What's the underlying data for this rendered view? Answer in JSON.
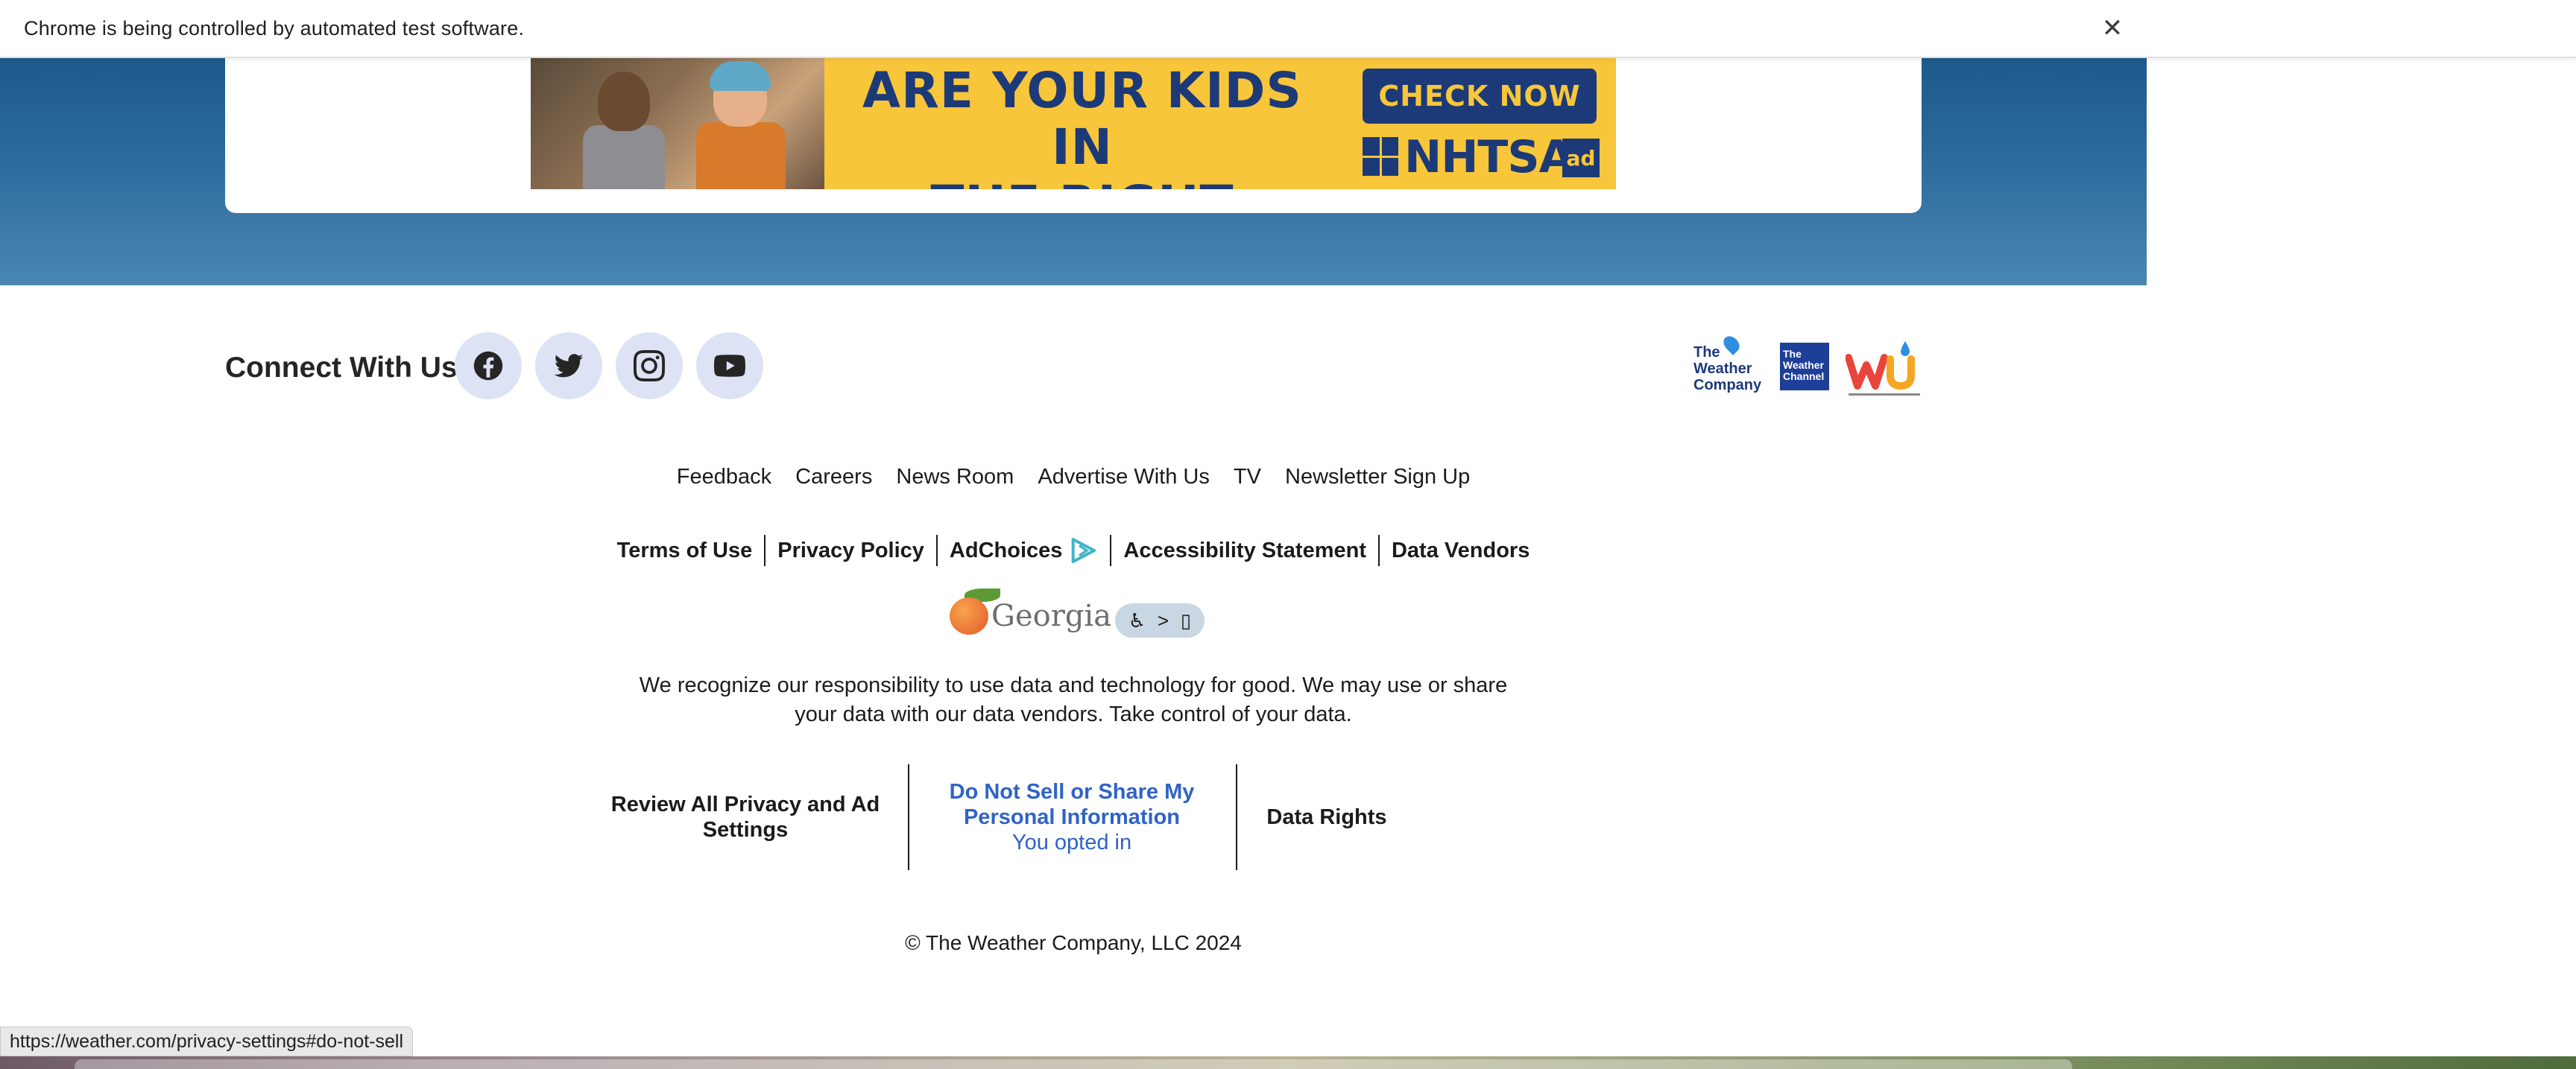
{
  "browser": {
    "infobar_text": "Chrome is being controlled by automated test software.",
    "close_glyph": "✕",
    "status_url": "https://weather.com/privacy-settings#do-not-sell"
  },
  "ad": {
    "headline_line1": "ARE YOUR KIDS IN",
    "headline_line2": "THE RIGHT SEAT?",
    "cta": "CHECK NOW",
    "sponsor": "NHTSA",
    "council": "ad",
    "colors": {
      "background": "#f8c63a",
      "text": "#1d3a78"
    }
  },
  "connect": {
    "title": "Connect With Us",
    "social_icons": [
      "facebook-icon",
      "twitter-icon",
      "instagram-icon",
      "youtube-icon"
    ]
  },
  "brands": {
    "weather_company": "The Weather Company",
    "weather_channel": "The Weather Channel",
    "wunderground": "Weather Underground"
  },
  "nav_links": [
    "Feedback",
    "Careers",
    "News Room",
    "Advertise With Us",
    "TV",
    "Newsletter Sign Up"
  ],
  "legal_links": [
    "Terms of Use",
    "Privacy Policy",
    "AdChoices",
    "Accessibility Statement",
    "Data Vendors"
  ],
  "georgia": {
    "text": "Georgia"
  },
  "disclaimer": "We recognize our responsibility to use data and technology for good. We may use or share your data with our data vendors. Take control of your data.",
  "privacy": {
    "review": "Review All Privacy and Ad Settings",
    "do_not_sell": "Do Not Sell or Share My Personal Information",
    "opted_status": "You opted in",
    "data_rights": "Data Rights",
    "link_color": "#2f63c6"
  },
  "copyright": "© The Weather Company, LLC 2024"
}
